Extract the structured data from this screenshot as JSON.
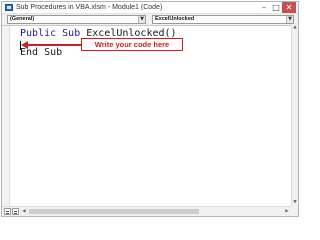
{
  "window": {
    "title": "Sub Procedures in VBA.xlsm - Module1 (Code)",
    "minimize_glyph": "–",
    "maximize_glyph": "□",
    "close_glyph": "✕",
    "app_icon": "vba-code-module-icon"
  },
  "combos": {
    "object": "(General)",
    "procedure": "ExcelUnlocked",
    "arrow_glyph": "▼"
  },
  "code": {
    "line1_keyword1": "Public",
    "line1_keyword2": "Sub",
    "line1_name": "ExcelUnlocked()",
    "line3_keyword": "End Sub"
  },
  "annotation": {
    "text": "Write your code here",
    "color": "#cc1f1f"
  },
  "scrollbars": {
    "up_glyph": "▲",
    "down_glyph": "▼",
    "left_glyph": "◀",
    "right_glyph": "▶"
  }
}
